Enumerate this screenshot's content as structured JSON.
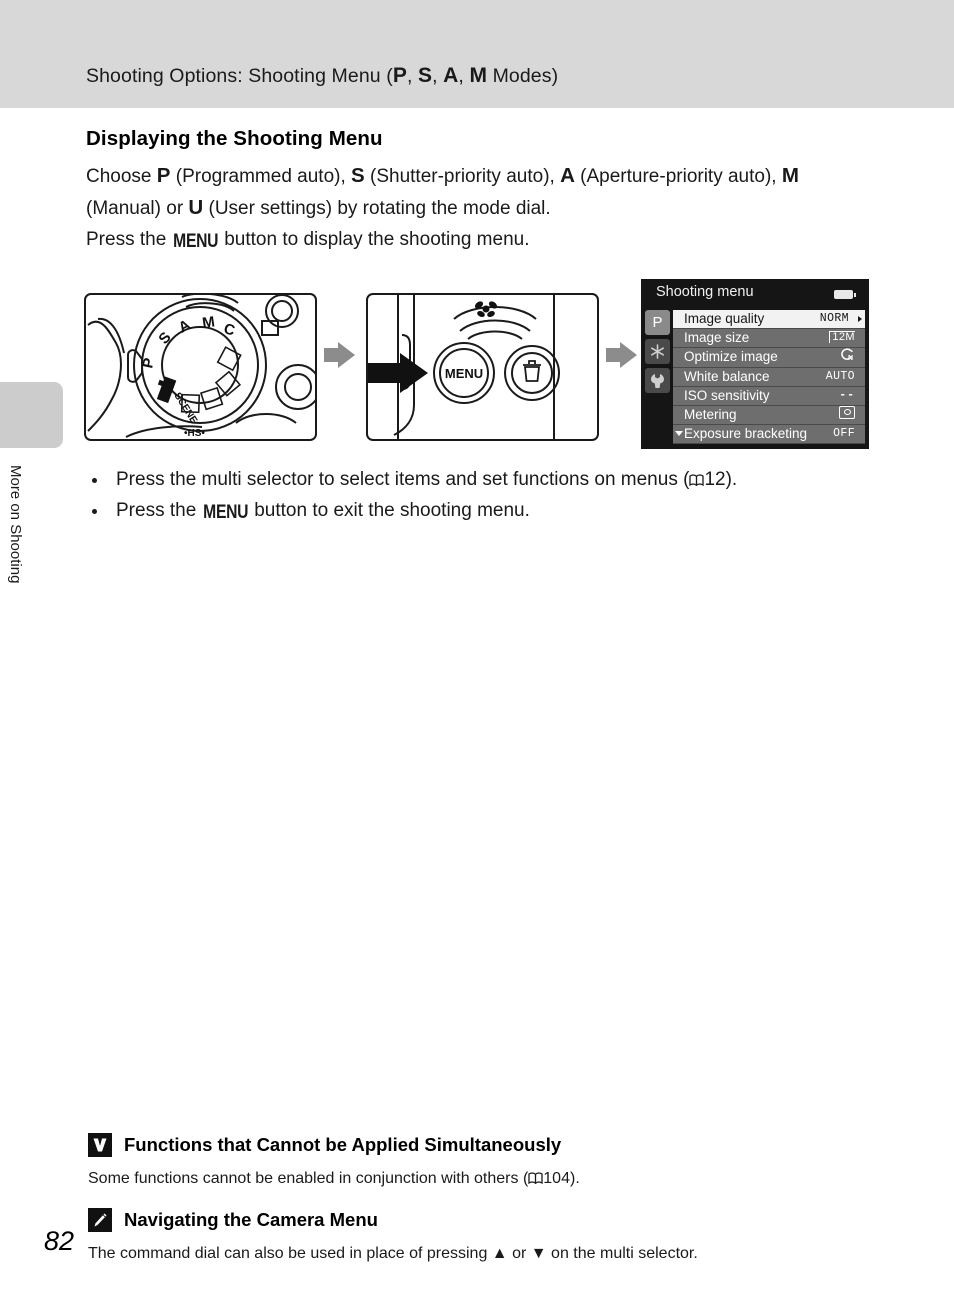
{
  "header": {
    "title_pre": "Shooting Options: Shooting Menu (",
    "mode_p": "P",
    "sep1": ", ",
    "mode_s": "S",
    "sep2": ", ",
    "mode_a": "A",
    "sep3": ", ",
    "mode_m": "M",
    "title_post": " Modes)"
  },
  "side_tab": {
    "label": "More on Shooting"
  },
  "page": {
    "number": "82"
  },
  "section": {
    "heading": "Displaying the Shooting Menu"
  },
  "intro": {
    "t1": "Choose ",
    "p": "P",
    "t2": " (Programmed auto), ",
    "s": "S",
    "t3": " (Shutter-priority auto), ",
    "a": "A",
    "t4": " (Aperture-priority auto), ",
    "m": "M",
    "t5": " (Manual) or ",
    "u": "U",
    "t6": " (User settings) by rotating the mode dial.",
    "t7": "Press the ",
    "menu_btn": "MENU",
    "t8": " button to display the shooting menu."
  },
  "figures": {
    "dial_figure_name": "camera-mode-dial-illustration",
    "dial_labels": [
      "S",
      "A",
      "M",
      "C",
      "P",
      "SCENE"
    ],
    "menu_button_figure_name": "camera-menu-button-illustration",
    "menu_button_label": "MENU",
    "hs_label": "HS"
  },
  "camera_menu": {
    "title": "Shooting menu",
    "battery_icon": "battery-icon",
    "tabs": [
      {
        "name": "shooting-tab",
        "glyph": "P",
        "active": true
      },
      {
        "name": "movie-tab",
        "glyph": "❄",
        "active": false
      },
      {
        "name": "setup-tab",
        "glyph": "ὒ7",
        "active": false
      }
    ],
    "items": [
      {
        "label": "Image quality",
        "value": "NORM",
        "selected": true,
        "has_arrow": true,
        "icon": "text"
      },
      {
        "label": "Image size",
        "value": "12M",
        "selected": false,
        "has_arrow": false,
        "icon": "image-size-icon"
      },
      {
        "label": "Optimize image",
        "value": "CN",
        "selected": false,
        "has_arrow": false,
        "icon": "optimize-image-icon"
      },
      {
        "label": "White balance",
        "value": "AUTO",
        "selected": false,
        "has_arrow": false,
        "icon": "text"
      },
      {
        "label": "ISO sensitivity",
        "value": "--",
        "selected": false,
        "has_arrow": false,
        "icon": "dashes-icon"
      },
      {
        "label": "Metering",
        "value": "",
        "selected": false,
        "has_arrow": false,
        "icon": "metering-icon"
      },
      {
        "label": "Exposure bracketing",
        "value": "OFF",
        "selected": false,
        "has_arrow": false,
        "icon": "text",
        "scroll_caret": true
      }
    ]
  },
  "bullets": [
    {
      "pre": "Press the multi selector to select items and set functions on menus (",
      "ref": "12",
      "post": ")."
    },
    {
      "pre": "Press the ",
      "bold": "MENU",
      "post": " button to exit the shooting menu."
    }
  ],
  "notes": [
    {
      "badge": "caution-icon",
      "badge_glyph": "V",
      "title": "Functions that Cannot be Applied Simultaneously",
      "body_pre": "Some functions cannot be enabled in conjunction with others (",
      "body_ref": "104",
      "body_post": ")."
    },
    {
      "badge": "pencil-icon",
      "badge_glyph": "✎",
      "title": "Navigating the Camera Menu",
      "body_pre": "The command dial can also be used in place of pressing ",
      "up": "▲",
      "mid": " or ",
      "down": "▼",
      "body_post": " on the multi selector."
    }
  ]
}
